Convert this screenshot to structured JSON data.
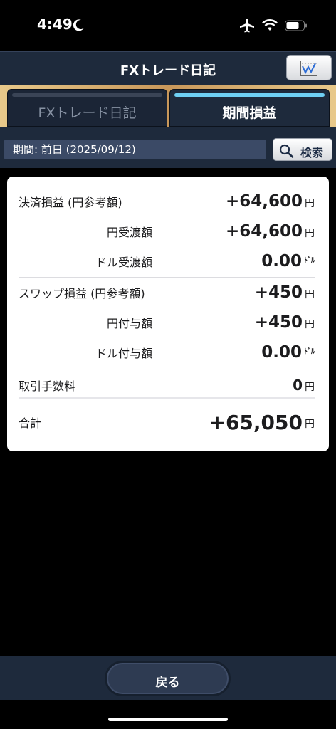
{
  "status_bar": {
    "time": "4:49"
  },
  "navbar": {
    "title": "FXトレード日記"
  },
  "tabs": [
    {
      "label": "FXトレード日記",
      "active": false
    },
    {
      "label": "期間損益",
      "active": true
    }
  ],
  "period": {
    "text": "期間: 前日 (2025/09/12)",
    "search_label": "検索"
  },
  "summary": {
    "settlement_label": "決済損益 (円参考額)",
    "settlement_value": "+64,600",
    "settlement_unit": "円",
    "yen_transfer_label": "円受渡額",
    "yen_transfer_value": "+64,600",
    "yen_transfer_unit": "円",
    "dollar_transfer_label": "ドル受渡額",
    "dollar_transfer_value": "0.00",
    "dollar_transfer_unit": "ﾄﾞﾙ",
    "swap_label": "スワップ損益 (円参考額)",
    "swap_value": "+450",
    "swap_unit": "円",
    "yen_grant_label": "円付与額",
    "yen_grant_value": "+450",
    "yen_grant_unit": "円",
    "dollar_grant_label": "ドル付与額",
    "dollar_grant_value": "0.00",
    "dollar_grant_unit": "ﾄﾞﾙ",
    "fee_label": "取引手数料",
    "fee_value": "0",
    "fee_unit": "円",
    "total_label": "合計",
    "total_value": "+65,050",
    "total_unit": "円"
  },
  "bottom": {
    "back_label": "戻る"
  },
  "colors": {
    "navy": "#1e2a3c",
    "tab_active_bar": "#6fd0f4",
    "gold": "#c8975a"
  }
}
